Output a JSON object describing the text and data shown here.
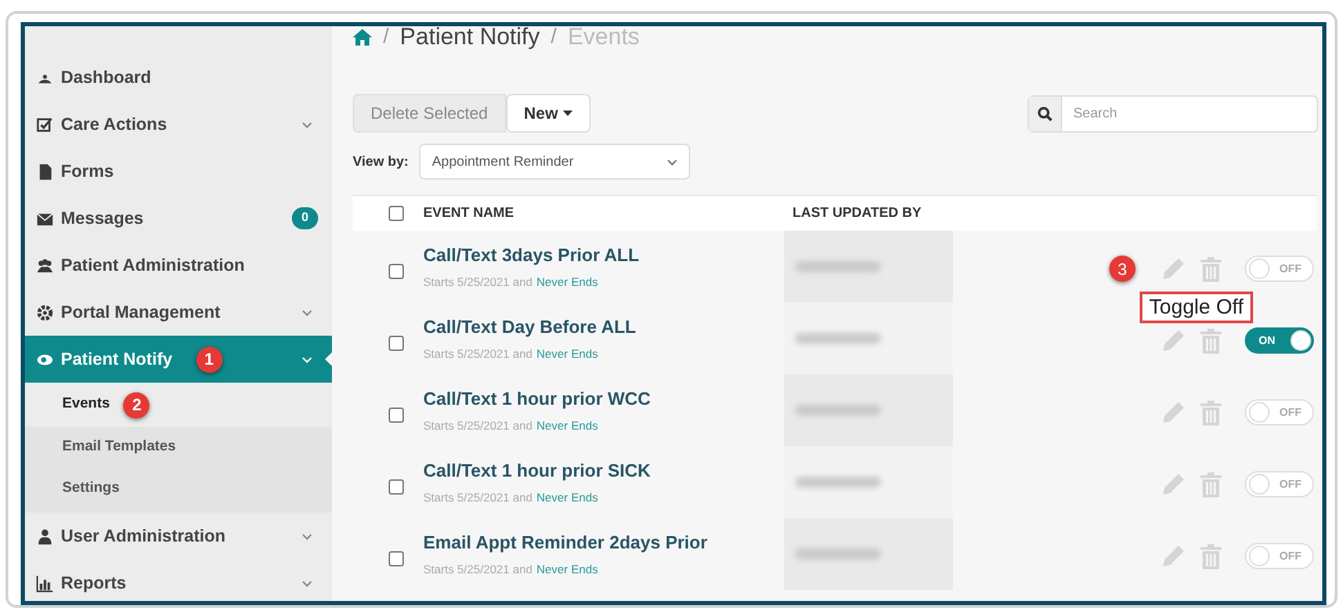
{
  "breadcrumb": [
    {
      "separator": "/",
      "label": "Patient Notify"
    },
    {
      "separator": "/",
      "label": "Events"
    }
  ],
  "sidebar": {
    "items": [
      {
        "label": "Dashboard",
        "selected": false,
        "has_chevron": false
      },
      {
        "label": "Care Actions",
        "selected": false,
        "has_chevron": true
      },
      {
        "label": "Forms",
        "selected": false,
        "has_chevron": false
      },
      {
        "label": "Messages",
        "selected": false,
        "has_chevron": false,
        "badge": "0"
      },
      {
        "label": "Patient Administration",
        "selected": false,
        "has_chevron": false
      },
      {
        "label": "Portal Management",
        "selected": false,
        "has_chevron": true
      },
      {
        "label": "Patient Notify",
        "selected": true,
        "has_chevron": true,
        "marker": "1",
        "children": [
          {
            "label": "Events",
            "selected": true,
            "marker": "2"
          },
          {
            "label": "Email Templates",
            "selected": false
          },
          {
            "label": "Settings",
            "selected": false
          }
        ]
      },
      {
        "label": "User Administration",
        "selected": false,
        "has_chevron": true
      },
      {
        "label": "Reports",
        "selected": false,
        "has_chevron": true
      }
    ]
  },
  "toolbar": {
    "delete_button": {
      "label": "Delete Selected",
      "disabled": true
    },
    "new_button": {
      "label": "New"
    },
    "search": {
      "placeholder": "Search"
    },
    "view_by": {
      "label": "View by:",
      "value": "Appointment Reminder"
    }
  },
  "table": {
    "select_all_checked": false,
    "columns": [
      "EVENT NAME",
      "LAST UPDATED BY"
    ],
    "rows": [
      {
        "name": "Call/Text 3days Prior ALL",
        "schedule": "Starts 5/25/2021 and",
        "end": "Never Ends",
        "checked": false,
        "on": false,
        "toggle_label": "OFF",
        "marker": "3",
        "callout": "Toggle Off"
      },
      {
        "name": "Call/Text Day Before ALL",
        "schedule": "Starts 5/25/2021 and",
        "end": "Never Ends",
        "checked": false,
        "on": true,
        "toggle_label": "ON"
      },
      {
        "name": "Call/Text 1 hour prior WCC",
        "schedule": "Starts 5/25/2021 and",
        "end": "Never Ends",
        "checked": false,
        "on": false,
        "toggle_label": "OFF"
      },
      {
        "name": "Call/Text 1 hour prior SICK",
        "schedule": "Starts 5/25/2021 and",
        "end": "Never Ends",
        "checked": false,
        "on": false,
        "toggle_label": "OFF"
      },
      {
        "name": "Email Appt Reminder 2days Prior",
        "schedule": "Starts 5/25/2021 and",
        "end": "Never Ends",
        "checked": false,
        "on": false,
        "toggle_label": "OFF"
      }
    ]
  }
}
